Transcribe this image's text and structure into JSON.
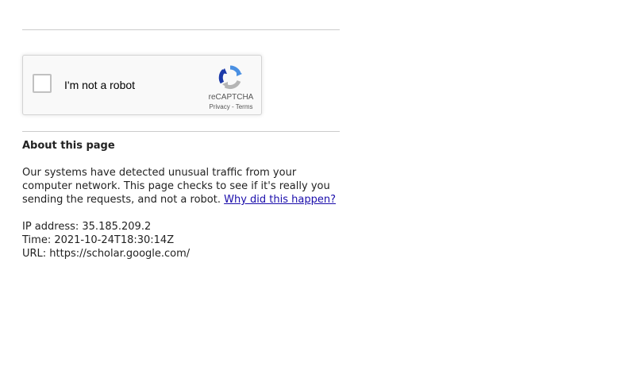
{
  "captcha": {
    "label": "I'm not a robot",
    "brand": "reCAPTCHA",
    "privacy_link": "Privacy",
    "separator": "-",
    "terms_link": "Terms",
    "logo_icon": "recaptcha-logo-icon",
    "colors": {
      "logo_blue": "#4a90e2",
      "logo_dark_blue": "#1c3aa9",
      "logo_gray": "#b5b5b5"
    }
  },
  "about": {
    "heading": "About this page",
    "paragraph_text": "Our systems have detected unusual traffic from your computer network. This page checks to see if it's really you sending the requests, and not a robot.",
    "why_link": "Why did this happen?"
  },
  "info": {
    "ip_line": "IP address: 35.185.209.2",
    "time_line": "Time: 2021-10-24T18:30:14Z",
    "url_line": "URL: https://scholar.google.com/"
  }
}
